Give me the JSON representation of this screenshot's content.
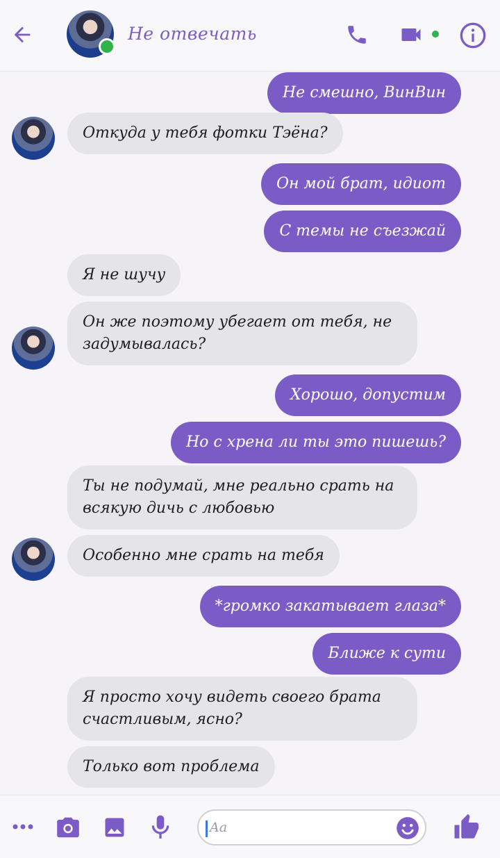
{
  "header": {
    "title": "Не отвечать"
  },
  "messages": [
    {
      "side": "out",
      "text": "Не смешно, ВинВин"
    },
    {
      "side": "in",
      "text": "Откуда у тебя фотки Тэёна?"
    },
    {
      "side": "out",
      "text": "Он мой брат, идиот"
    },
    {
      "side": "out",
      "text": "С темы не съезжай"
    },
    {
      "side": "in",
      "text": "Я не шучу"
    },
    {
      "side": "in",
      "text": "Он же поэтому убегает от тебя, не задумывалась?"
    },
    {
      "side": "out",
      "text": "Хорошо, допустим"
    },
    {
      "side": "out",
      "text": "Но с хрена ли ты это пишешь?"
    },
    {
      "side": "in",
      "text": "Ты не подумай, мне реально срать на всякую дичь с любовью"
    },
    {
      "side": "in",
      "text": "Особенно мне срать на тебя"
    },
    {
      "side": "out",
      "text": "*громко закатывает глаза*"
    },
    {
      "side": "out",
      "text": "Ближе к сути"
    },
    {
      "side": "in",
      "text": "Я просто хочу видеть своего брата счастливым, ясно?"
    },
    {
      "side": "in",
      "text": "Только вот проблема"
    }
  ],
  "composer": {
    "placeholder": "Aa"
  },
  "colors": {
    "accent": "#7b5cc7",
    "incoming_bubble": "#e5e4e8",
    "online": "#2fb34a"
  },
  "icons": {
    "back": "arrow-left-icon",
    "call": "phone-icon",
    "video": "video-camera-icon",
    "info": "info-icon",
    "more": "more-dots-icon",
    "camera": "camera-icon",
    "gallery": "image-icon",
    "mic": "microphone-icon",
    "emoji": "emoji-icon",
    "like": "thumbs-up-icon"
  }
}
